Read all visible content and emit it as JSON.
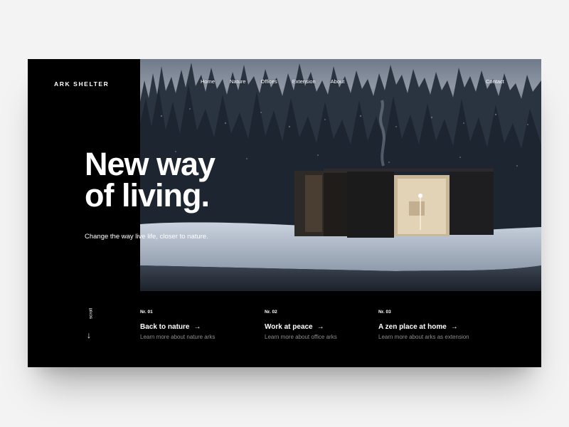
{
  "brand": {
    "logo": "ARK SHELTER"
  },
  "nav": {
    "items": [
      "Home",
      "Nature",
      "Offices",
      "Extension",
      "About"
    ],
    "contact": "Contact"
  },
  "hero": {
    "headline_line1": "New way",
    "headline_line2": "of living.",
    "subline": "Change the way live life, closer to nature."
  },
  "scroll": {
    "label": "scroll",
    "arrow": "↓"
  },
  "features": [
    {
      "nr": "Nr. 01",
      "title": "Back to nature",
      "arrow": "→",
      "desc": "Learn more about nature arks"
    },
    {
      "nr": "Nr. 02",
      "title": "Work at peace",
      "arrow": "→",
      "desc": "Learn more about office arks"
    },
    {
      "nr": "Nr. 03",
      "title": "A zen place at home",
      "arrow": "→",
      "desc": "Learn more about arks as extension"
    }
  ],
  "colors": {
    "background": "#f3f3f4",
    "panel": "#000000",
    "text": "#ffffff",
    "muted_text": "#8d8d8d"
  }
}
